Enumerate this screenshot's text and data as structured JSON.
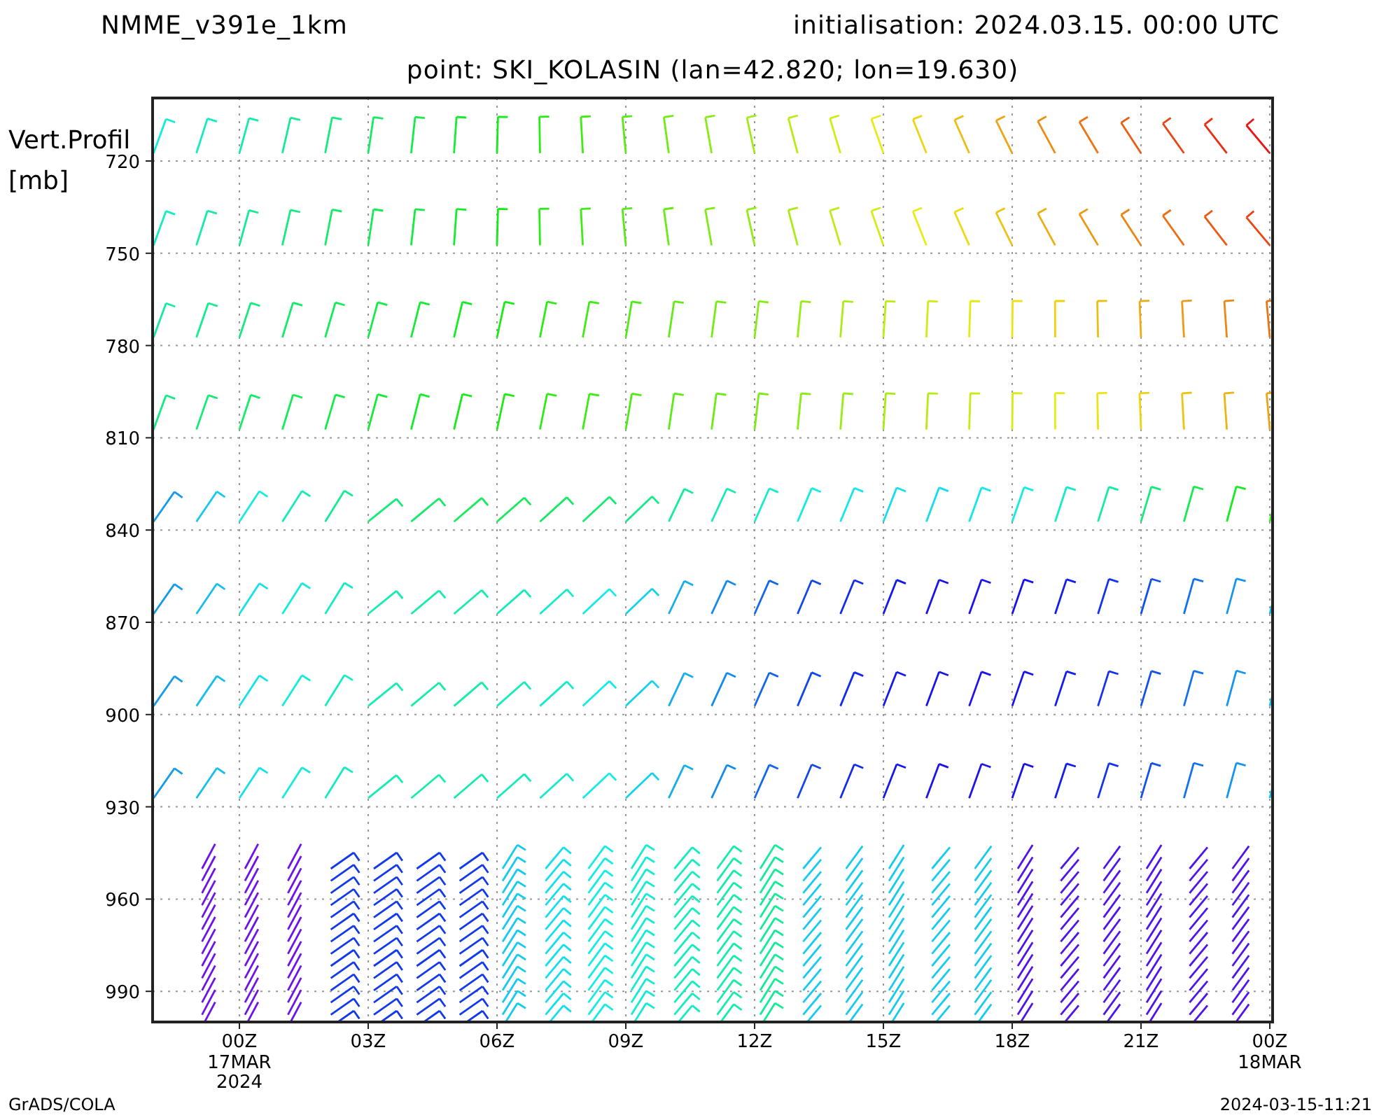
{
  "header": {
    "model": "NMME_v391e_1km",
    "initialisation": "initialisation: 2024.03.15. 00:00 UTC"
  },
  "subtitle": "point: SKI_KOLASIN (lan=42.820; lon=19.630)",
  "plot": {
    "ylabel_lines": [
      "Vert.Profil",
      "[mb]"
    ],
    "yticks": [
      "720",
      "750",
      "780",
      "810",
      "840",
      "870",
      "900",
      "930",
      "960",
      "990"
    ],
    "xticks": [
      {
        "label": "00Z",
        "sublines": [
          "17MAR",
          "2024"
        ]
      },
      {
        "label": "03Z"
      },
      {
        "label": "06Z"
      },
      {
        "label": "09Z"
      },
      {
        "label": "12Z"
      },
      {
        "label": "15Z"
      },
      {
        "label": "18Z"
      },
      {
        "label": "21Z"
      },
      {
        "label": "00Z",
        "sublines": [
          "18MAR"
        ]
      }
    ]
  },
  "footer": {
    "left": "GrADS/COLA",
    "right": "2024-03-15-11:21"
  }
}
